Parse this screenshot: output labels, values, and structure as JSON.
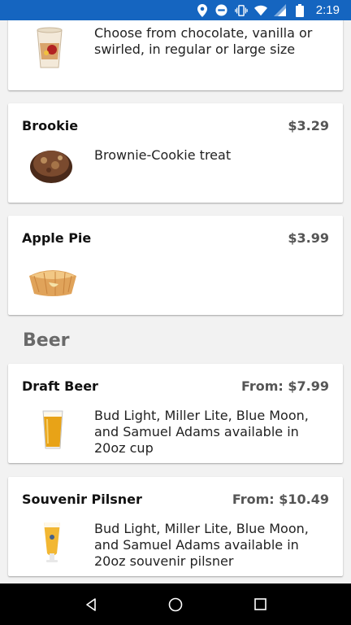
{
  "status_bar": {
    "time": "2:19",
    "icons": [
      "location-icon",
      "do-not-disturb-icon",
      "vibrate-icon",
      "wifi-icon",
      "cell-signal-icon",
      "battery-icon"
    ]
  },
  "items": [
    {
      "desc": "Choose from chocolate, vanilla or swirled, in regular or large size",
      "image": "soft-serve-cup"
    },
    {
      "title": "Brookie",
      "price": "$3.29",
      "desc": "Brownie-Cookie treat",
      "image": "brookie"
    },
    {
      "title": "Apple Pie",
      "price": "$3.99",
      "desc": "",
      "image": "apple-pie"
    }
  ],
  "section": {
    "heading": "Beer"
  },
  "beer_items": [
    {
      "title": "Draft Beer",
      "price": "From: $7.99",
      "desc": "Bud Light, Miller Lite, Blue Moon, and Samuel Adams available in 20oz cup",
      "image": "draft-beer-cup"
    },
    {
      "title": "Souvenir Pilsner",
      "price": "From: $10.49",
      "desc": "Bud Light, Miller Lite, Blue Moon, and Samuel Adams available in 20oz souvenir pilsner",
      "image": "pilsner-glass"
    }
  ],
  "nav": {
    "icons": [
      "back-icon",
      "home-icon",
      "recents-icon"
    ]
  },
  "colors": {
    "status_bar": "#1565c0",
    "heading": "#6a6a6a",
    "price": "#555555"
  }
}
